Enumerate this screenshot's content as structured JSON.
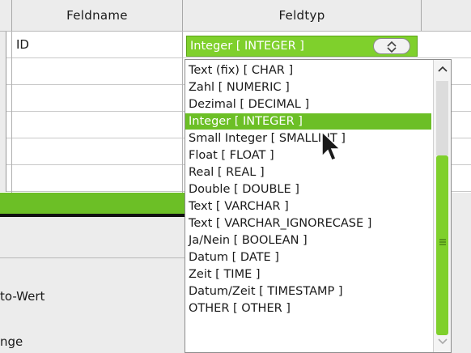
{
  "table": {
    "headers": {
      "field_name": "Feldname",
      "field_type": "Feldtyp"
    },
    "rows": [
      {
        "field_name": "ID",
        "field_type": "Integer [ INTEGER ]"
      }
    ]
  },
  "combo": {
    "value": "Integer [ INTEGER ]",
    "button_icon": "up-down-arrows-icon"
  },
  "lower_panel": {
    "labels": [
      "to-Wert",
      "nge"
    ]
  },
  "dropdown": {
    "options": [
      "Text (fix) [ CHAR ]",
      "Zahl [ NUMERIC ]",
      "Dezimal [ DECIMAL ]",
      "Integer [ INTEGER ]",
      "Small Integer [ SMALLINT ]",
      "Float [ FLOAT ]",
      "Real [ REAL ]",
      "Double [ DOUBLE ]",
      "Text [ VARCHAR ]",
      "Text [ VARCHAR_IGNORECASE ]",
      "Ja/Nein [ BOOLEAN ]",
      "Datum [ DATE ]",
      "Zeit [ TIME ]",
      "Datum/Zeit [ TIMESTAMP ]",
      "OTHER [ OTHER ]"
    ],
    "selected_index": 3
  },
  "colors": {
    "accent": "#6cbf26",
    "accent_light": "#7fd02c",
    "background": "#ececec"
  }
}
